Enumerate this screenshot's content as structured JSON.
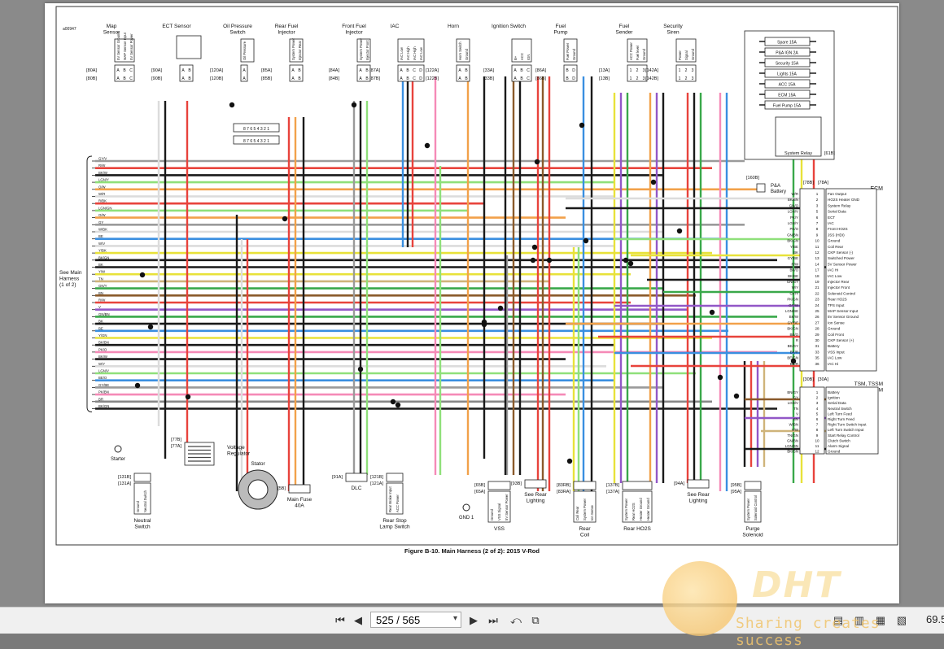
{
  "document": {
    "id_code": "a00947",
    "caption": "Figure B-10. Main Harness (2 of 2): 2015 V-Rod"
  },
  "components_top": [
    {
      "name": "Map\nSensor",
      "conn": [
        "[80A]",
        "[80B]"
      ],
      "pins": [
        "5V Sensor Ground",
        "MAP Sensor Input",
        "5V Sensor Power"
      ],
      "pinlabels": [
        "A",
        "B",
        "C"
      ]
    },
    {
      "name": "ECT Sensor",
      "conn": [
        "[90A]",
        "[90B]"
      ],
      "pins": [],
      "pinlabels": [
        "A",
        "B"
      ]
    },
    {
      "name": "Oil Pressure\nSwitch",
      "conn": [
        "[120A]",
        "[120B]"
      ],
      "pins": [
        "Oil Pressure"
      ],
      "pinlabels": [
        "A"
      ]
    },
    {
      "name": "Rear Fuel\nInjector",
      "conn": [
        "[85A]",
        "[85B]"
      ],
      "pins": [
        "System Power",
        "Injector Rear"
      ],
      "pinlabels": [
        "A",
        "B"
      ]
    },
    {
      "name": "Front Fuel\nInjector",
      "conn": [
        "[84A]",
        "[84B]"
      ],
      "pins": [
        "System Power",
        "Injector Front"
      ],
      "pinlabels": [
        "A",
        "B"
      ]
    },
    {
      "name": "IAC",
      "conn": [
        "[87A]",
        "[87B]"
      ],
      "pins": [
        "IAC Low",
        "IAC High",
        "IAC High",
        "IAC Low"
      ],
      "pinlabels": [
        "A",
        "B",
        "C",
        "D"
      ]
    },
    {
      "name": "Horn",
      "conn": [
        "[122A]",
        "[122B]"
      ],
      "pins": [
        "Horn Switch",
        "Ground"
      ],
      "pinlabels": [
        "A",
        "B"
      ]
    },
    {
      "name": "Ignition Switch",
      "conn": [
        "[33A]",
        "[33B]"
      ],
      "pins": [
        "B+",
        "ACC",
        "IGN"
      ],
      "pinlabels": [
        "A",
        "B",
        "C"
      ]
    },
    {
      "name": "Fuel\nPump",
      "conn": [
        "[86A]",
        "[86B]"
      ],
      "pins": [
        "Fuel Power",
        "Ground"
      ],
      "pinlabels": [
        "B",
        "D"
      ]
    },
    {
      "name": "Fuel\nSender",
      "conn": [
        "[13A]",
        "[13B]"
      ],
      "pins": [
        "ACC Power",
        "Fuel level",
        "Ground"
      ],
      "pinlabels": [
        "1",
        "2",
        "3"
      ]
    },
    {
      "name": "Security\nSiren",
      "conn": [
        "[142A]",
        "[142B]"
      ],
      "pins": [
        "Power",
        "Signal",
        "Ground"
      ],
      "pinlabels": [
        "1",
        "2",
        "3"
      ]
    }
  ],
  "fuse_block": {
    "fuses": [
      "Spare 15A",
      "P&A IGN 2A",
      "Security 15A",
      "Lights 15A",
      "ACC 15A",
      "ECM 15A",
      "Fuel Pump 15A"
    ],
    "relay": "System Relay",
    "relay_conn": "[61B]",
    "pa_battery": "P&A\nBattery",
    "pa_conn": "[160B]"
  },
  "left_wires": [
    "GY/V",
    "R/W",
    "BK/W",
    "LGN/Y",
    "O/W",
    "W/R",
    "R/BK",
    "LGN/GN",
    "O/W",
    "GY",
    "W/BK",
    "BE",
    "W/V",
    "Y/BK",
    "BK/GN",
    "BK",
    "Y/W",
    "TN",
    "GN/Y",
    "BN",
    "R/W",
    "V",
    "GN/BN",
    "BK",
    "BE",
    "Y/GN",
    "BK/BN",
    "PK/O",
    "BK/W",
    "W/Y",
    "LGN/V",
    "BE/O",
    "GY/BE",
    "PK/BN",
    "BR",
    "BK/GN"
  ],
  "left_bracket": "See Main\nHarness\n(1 of 2)",
  "ecm": {
    "title": "ECM",
    "conns": [
      "[78B]",
      "[78A]"
    ],
    "rows": [
      {
        "wire": "W/R",
        "pin": "1",
        "func": "Fan Output"
      },
      {
        "wire": "BK/BN",
        "pin": "2",
        "func": "HO2S Heater GND"
      },
      {
        "wire": "GN/O",
        "pin": "3",
        "func": "System Relay"
      },
      {
        "wire": "LGN/V",
        "pin": "5",
        "func": "Serial Data"
      },
      {
        "wire": "PK/Y",
        "pin": "6",
        "func": "ECT"
      },
      {
        "wire": "LGN/Y",
        "pin": "7",
        "func": "IAC"
      },
      {
        "wire": "PK/O",
        "pin": "8",
        "func": "Front HO2S"
      },
      {
        "wire": "GN/BN",
        "pin": "9",
        "func": "JSS (HDI)"
      },
      {
        "wire": "BK/GN",
        "pin": "10",
        "func": "Ground"
      },
      {
        "wire": "Y/BE",
        "pin": "11",
        "func": "Coil Rear"
      },
      {
        "wire": "BK",
        "pin": "12",
        "func": "CKP Sensor (-)"
      },
      {
        "wire": "GY/BE",
        "pin": "13",
        "func": "Switched Power"
      },
      {
        "wire": "R/W",
        "pin": "14",
        "func": "5V Sensor Power"
      },
      {
        "wire": "BK/O",
        "pin": "17",
        "func": "IAC Hi"
      },
      {
        "wire": "BK/BE",
        "pin": "18",
        "func": "IAC Low"
      },
      {
        "wire": "GN/GY",
        "pin": "19",
        "func": "Injector Rear"
      },
      {
        "wire": "W/Y",
        "pin": "21",
        "func": "Injector Front"
      },
      {
        "wire": "GY/Y",
        "pin": "22",
        "func": "Solenoid Control"
      },
      {
        "wire": "PK/GN",
        "pin": "23",
        "func": "Rear HO2S"
      },
      {
        "wire": "GY/W",
        "pin": "24",
        "func": "TPS Input"
      },
      {
        "wire": "LGN/BE",
        "pin": "25",
        "func": "MAP Sensor Input"
      },
      {
        "wire": "BK/W",
        "pin": "26",
        "func": "5V Sensor Ground"
      },
      {
        "wire": "GY/BE",
        "pin": "27",
        "func": "Ion Sense"
      },
      {
        "wire": "BK/GN",
        "pin": "28",
        "func": "Ground"
      },
      {
        "wire": "BE/O",
        "pin": "29",
        "func": "Coil Front"
      },
      {
        "wire": "R",
        "pin": "30",
        "func": "CKP Sensor (+)"
      },
      {
        "wire": "BE/GY",
        "pin": "31",
        "func": "Battery"
      },
      {
        "wire": "BK/R",
        "pin": "33",
        "func": "VSS Input"
      },
      {
        "wire": "BE/GN",
        "pin": "35",
        "func": "IAC Low"
      },
      {
        "wire": "BK/R",
        "pin": "36",
        "func": "IAC Hi"
      }
    ]
  },
  "tsm": {
    "title": "TSM, TSSM\nor HFSM",
    "conns": [
      "[30B]",
      "[30A]"
    ],
    "rows": [
      {
        "wire": "BN/GY",
        "pin": "1",
        "func": "Battery"
      },
      {
        "wire": "GY",
        "pin": "2",
        "func": "Ignition"
      },
      {
        "wire": "LGN/V",
        "pin": "3",
        "func": "Serial Data"
      },
      {
        "wire": "TN",
        "pin": "4",
        "func": "Neutral Switch"
      },
      {
        "wire": "V",
        "pin": "5",
        "func": "Left Turn Feed"
      },
      {
        "wire": "BN",
        "pin": "6",
        "func": "Right Turn Feed"
      },
      {
        "wire": "W/BN",
        "pin": "7",
        "func": "Right Turn Switch Input"
      },
      {
        "wire": "V/W",
        "pin": "8",
        "func": "Left Turn Switch Input"
      },
      {
        "wire": "TN/GN",
        "pin": "9",
        "func": "Start Relay Control"
      },
      {
        "wire": "GN/BN",
        "pin": "10",
        "func": "Clutch Switch"
      },
      {
        "wire": "LGN/BN",
        "pin": "11",
        "func": "Alarm Signal"
      },
      {
        "wire": "BK/GN",
        "pin": "12",
        "func": "Ground"
      }
    ]
  },
  "components_bottom": [
    {
      "name": "Starter"
    },
    {
      "name": "Neutral\nSwitch",
      "conn": [
        "[131B]",
        "[131A]"
      ],
      "pins": [
        "Ground",
        "Neutral Switch"
      ]
    },
    {
      "name": "Voltage\nRegulator",
      "conn": [
        "[77B]",
        "[77A]"
      ]
    },
    {
      "name": "Stator",
      "conn": [
        "[47B]",
        "[47A]"
      ]
    },
    {
      "name": "Main Fuse\n40A",
      "conn": [
        "[5B]"
      ]
    },
    {
      "name": "DLC",
      "conn": [
        "[91A]"
      ]
    },
    {
      "name": "Rear Stop\nLamp Switch",
      "conn": [
        "[121B]",
        "[121A]"
      ],
      "pins": [
        "Rear Brake Input",
        "ACC Power"
      ]
    },
    {
      "name": "GND 1"
    },
    {
      "name": "VSS",
      "conn": [
        "[65B]",
        "[65A]"
      ],
      "pins": [
        "Ground",
        "VSS Signal",
        "5V Sensor Power"
      ]
    },
    {
      "name": "See Rear\nLighting",
      "conn": [
        "[93B]"
      ]
    },
    {
      "name": "Rear\nCoil",
      "conn": [
        "[83RB]",
        "[83RA]"
      ],
      "pins": [
        "Coil Rear",
        "System Power",
        "Ion Sense"
      ]
    },
    {
      "name": "Rear HO2S",
      "conn": [
        "[137B]",
        "[137A]"
      ],
      "pins": [
        "System Power",
        "Rear HO2S",
        "Heater Ground",
        "Heater Ground"
      ]
    },
    {
      "name": "See Rear\nLighting",
      "conn": [
        "[94A]"
      ]
    },
    {
      "name": "Purge\nSolenoid",
      "conn": [
        "[95B]",
        "[95A]"
      ],
      "pins": [
        "System Power",
        "Solenoid Control"
      ]
    }
  ],
  "toolbar": {
    "page_value": "525 / 565",
    "zoom": "69.5"
  },
  "watermark": {
    "logo": "DHT",
    "slogan": "Sharing creates success"
  }
}
